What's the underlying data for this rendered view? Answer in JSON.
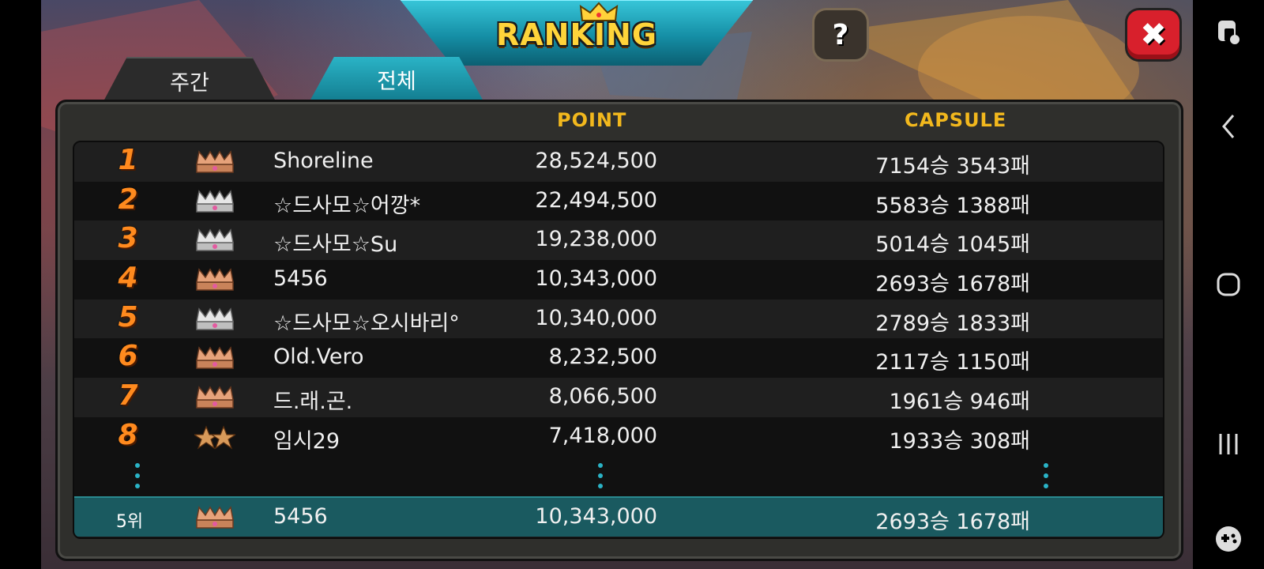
{
  "title": "RANKING",
  "tabs": [
    {
      "label": "주간",
      "active": false
    },
    {
      "label": "전체",
      "active": true
    }
  ],
  "buttons": {
    "help": "?",
    "close": "✖"
  },
  "columns": {
    "point": "POINT",
    "capsule": "CAPSULE"
  },
  "rows": [
    {
      "rank": "1",
      "badge": "bronze-crown",
      "name": "Shoreline",
      "point": "28,524,500",
      "capsule": "7154승 3543패"
    },
    {
      "rank": "2",
      "badge": "silver-crown",
      "name": "☆드사모☆어깡*",
      "point": "22,494,500",
      "capsule": "5583승 1388패"
    },
    {
      "rank": "3",
      "badge": "silver-crown",
      "name": "☆드사모☆Su",
      "point": "19,238,000",
      "capsule": "5014승 1045패"
    },
    {
      "rank": "4",
      "badge": "bronze-crown",
      "name": "5456",
      "point": "10,343,000",
      "capsule": "2693승 1678패"
    },
    {
      "rank": "5",
      "badge": "silver-crown",
      "name": "☆드사모☆오시바리°",
      "point": "10,340,000",
      "capsule": "2789승 1833패"
    },
    {
      "rank": "6",
      "badge": "bronze-crown",
      "name": "Old.Vero",
      "point": "8,232,500",
      "capsule": "2117승 1150패"
    },
    {
      "rank": "7",
      "badge": "bronze-crown",
      "name": "드.래.곤.",
      "point": "8,066,500",
      "capsule": "1961승 946패"
    },
    {
      "rank": "8",
      "badge": "two-stars",
      "name": "임시29",
      "point": "7,418,000",
      "capsule": "1933승 308패"
    }
  ],
  "my_row": {
    "rank": "5위",
    "badge": "bronze-crown",
    "name": "5456",
    "point": "10,343,000",
    "capsule": "2693승 1678패"
  },
  "colors": {
    "accent_teal": "#158ea5",
    "header_gold": "#f2b81d",
    "rank_orange": "#ff8a1e",
    "close_red": "#d8202c"
  },
  "system_nav": [
    "screen-lock-icon",
    "back-icon",
    "home-icon",
    "recents-icon",
    "game-launcher-icon"
  ]
}
